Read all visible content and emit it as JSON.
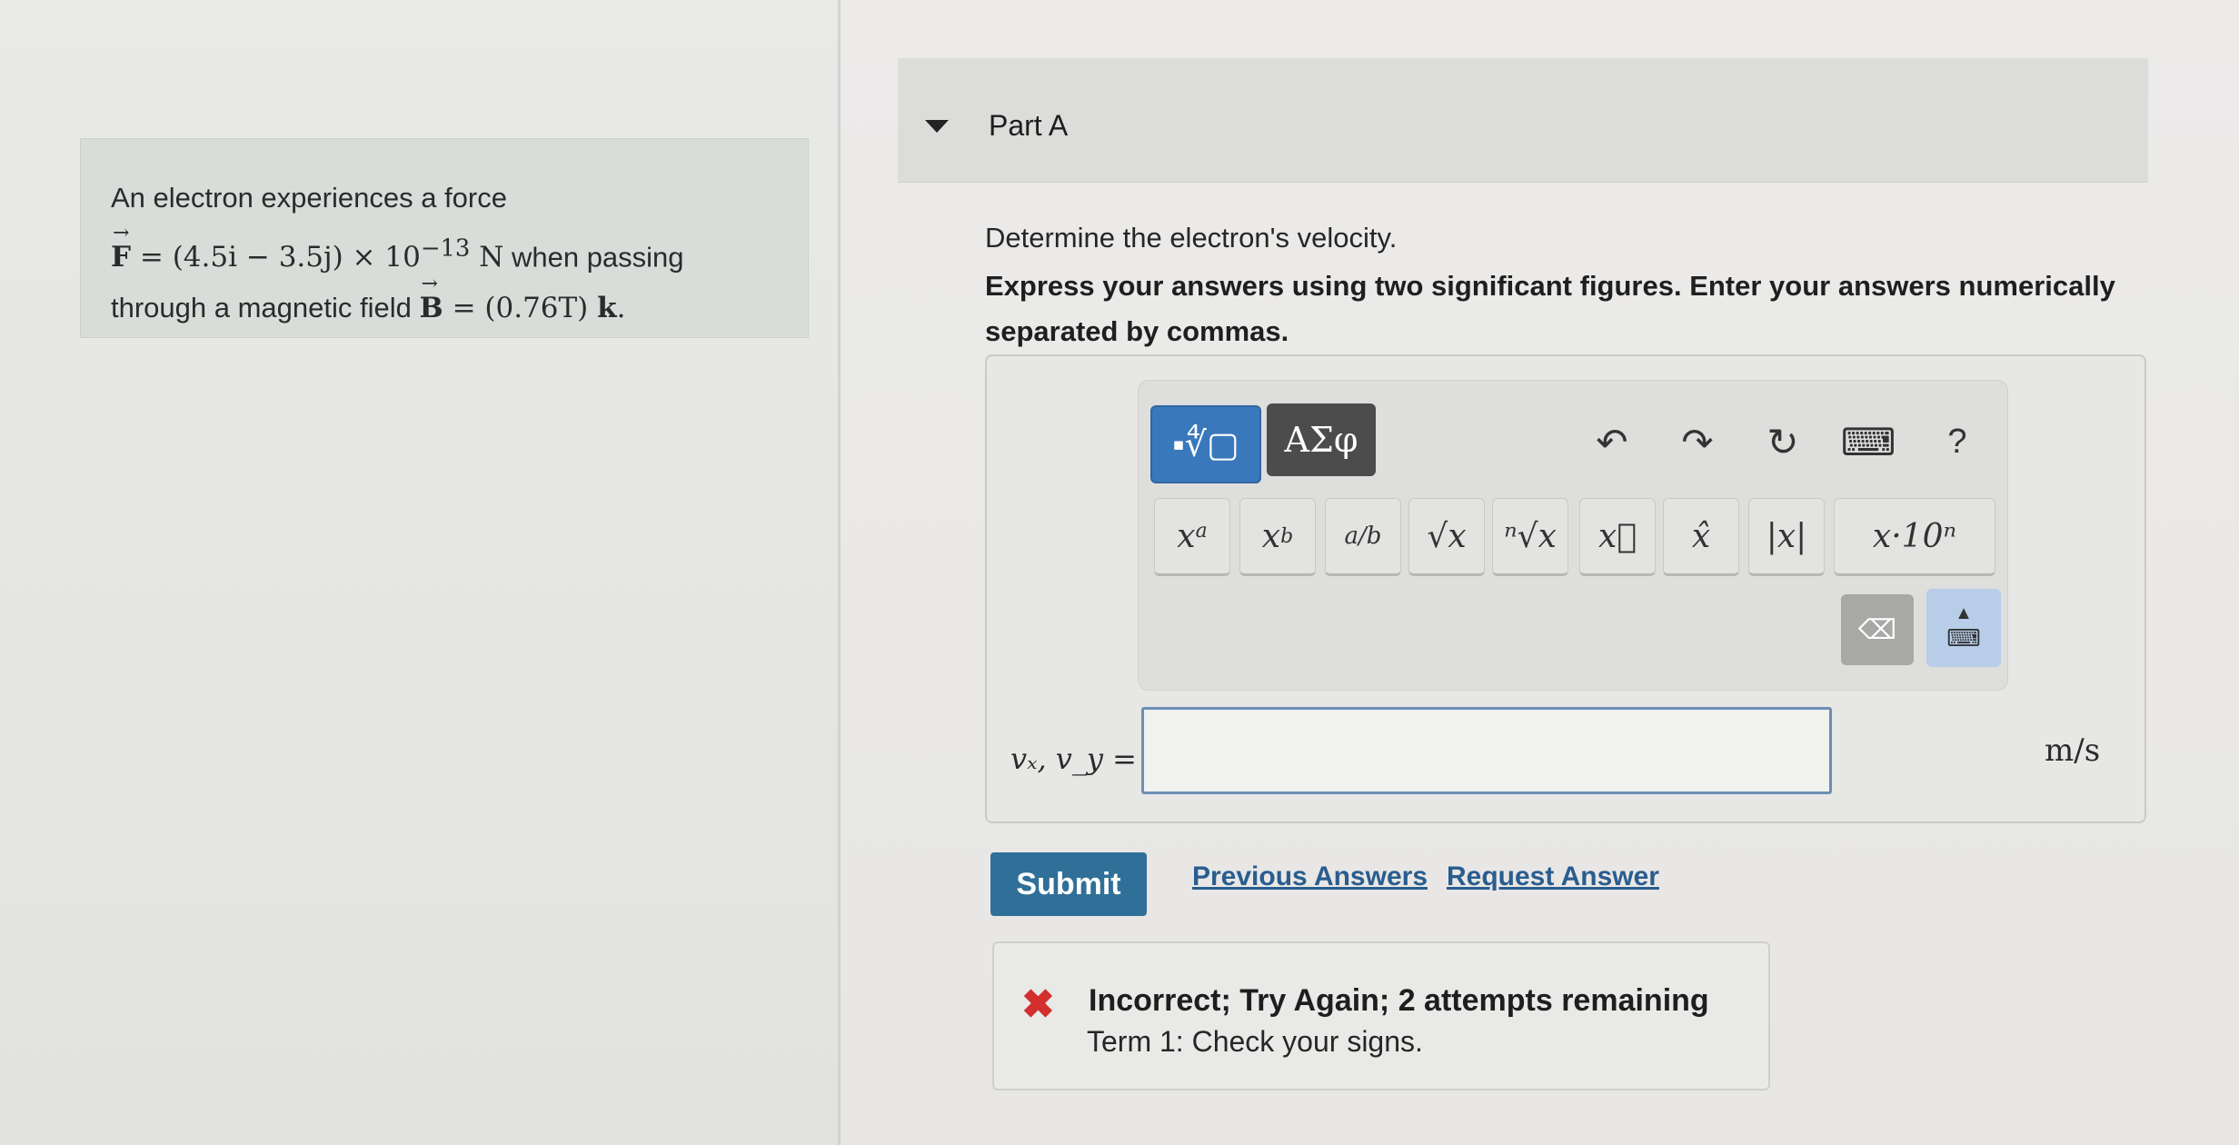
{
  "problem": {
    "intro": "An electron experiences a force",
    "force_symbol": "F",
    "force_expr": "= (4.5i − 3.5j) × 10",
    "force_exp": "−13",
    "force_unit": "N",
    "when_passing": "when passing",
    "field_prefix": "through a magnetic field",
    "field_symbol": "B",
    "field_expr": "= (0.76T)",
    "field_dir": "k",
    "field_period": "."
  },
  "part": {
    "title": "Part A",
    "question": "Determine the electron's velocity.",
    "instructions": "Express your answers using two significant figures. Enter your answers numerically separated by commas."
  },
  "toolbar": {
    "templates_icon": "templates-icon",
    "templates_glyph": "▪∜▢",
    "symbols_label": "ΑΣφ",
    "undo_glyph": "↶",
    "redo_glyph": "↷",
    "reset_glyph": "↻",
    "keyboard_glyph": "⌨",
    "help_label": "?",
    "keys": {
      "power_base": "x",
      "power_exp": "a",
      "sub_base": "x",
      "sub_idx": "b",
      "frac": "a/b",
      "sqrt": "√x",
      "nthroot": "ⁿ√x",
      "vector": "x⃗",
      "unit_vector": "x̂",
      "abs": "|x|",
      "sci_notation": "x·10ⁿ"
    },
    "backspace_glyph": "⌫",
    "keyboard_toggle_glyph": "▲"
  },
  "answer": {
    "label": "vₓ, v_y =",
    "value": "",
    "unit": "m/s"
  },
  "actions": {
    "submit": "Submit",
    "previous_answers": "Previous Answers",
    "request_answer": "Request Answer"
  },
  "feedback": {
    "icon": "error-x-icon",
    "glyph": "✖",
    "title": "Incorrect; Try Again; 2 attempts remaining",
    "message": "Term 1: Check your signs."
  },
  "colors": {
    "accent": "#2f6f98",
    "template_button": "#3a78bc",
    "error": "#d32f2f"
  }
}
